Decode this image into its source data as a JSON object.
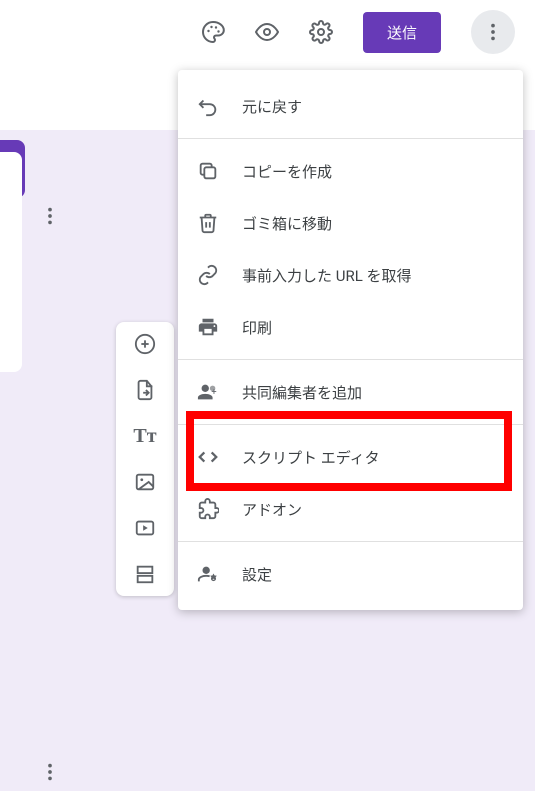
{
  "header": {
    "send_label": "送信"
  },
  "menu": {
    "undo": "元に戻す",
    "copy": "コピーを作成",
    "trash": "ゴミ箱に移動",
    "prefill": "事前入力した URL を取得",
    "print": "印刷",
    "collab": "共同編集者を追加",
    "script": "スクリプト エディタ",
    "addons": "アドオン",
    "settings": "設定"
  }
}
